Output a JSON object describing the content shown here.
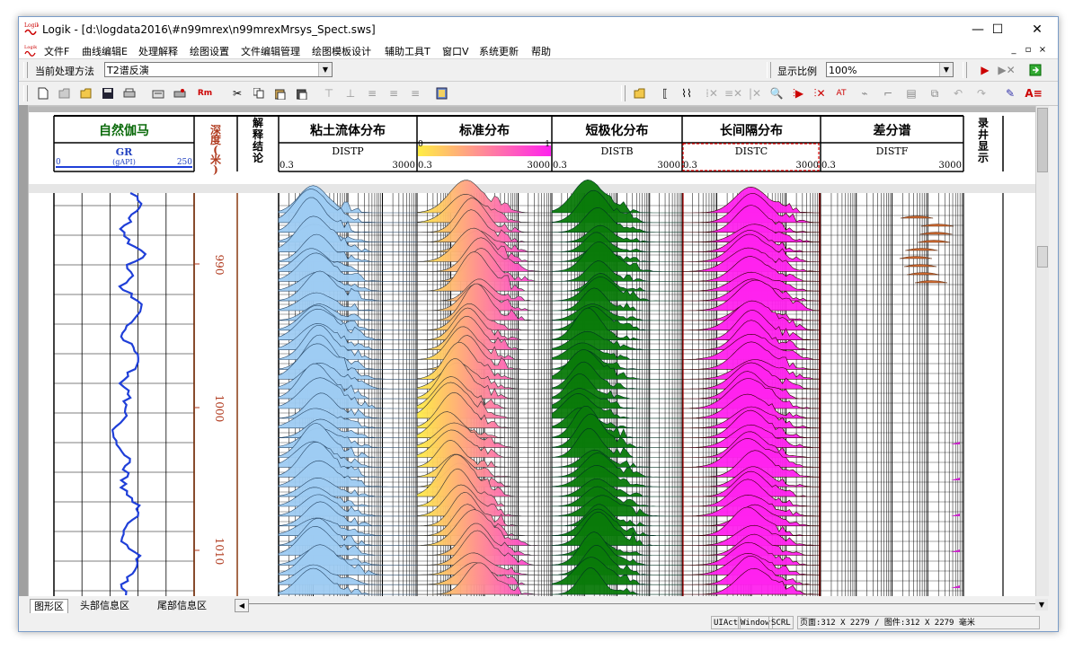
{
  "window": {
    "title": "Logik - [d:\\logdata2016\\#n99mrex\\n99mrexMrsys_Spect.sws]",
    "minimize_icon": "minimize-icon",
    "maximize_icon": "maximize-icon",
    "close_icon": "close-icon"
  },
  "menu": {
    "items": [
      "文件F",
      "曲线编辑E",
      "处理解释",
      "绘图设置",
      "文件编辑管理",
      "绘图模板设计",
      "辅助工具T",
      "窗口V",
      "系统更新",
      "帮助"
    ],
    "mdi_controls": [
      "_",
      "▫",
      "×"
    ]
  },
  "toolbar1": {
    "method_label": "当前处理方法",
    "method_value": "T2谱反演",
    "scale_label": "显示比例",
    "scale_value": "100%"
  },
  "toolbar2": {
    "rm_label": "Rm"
  },
  "tracks": {
    "gr": {
      "title": "自然伽马",
      "curve": "GR",
      "unit": "(gAPI)",
      "min": "0",
      "max": "250"
    },
    "depth": {
      "title": "深度(米)",
      "chars": [
        "深",
        "度",
        "(",
        "米",
        ")"
      ],
      "labels": [
        "990",
        "1000",
        "1010"
      ]
    },
    "interp": {
      "title": "解释结论",
      "chars": [
        "解",
        "释",
        "结",
        "论"
      ]
    },
    "distp": {
      "title": "粘土流体分布",
      "curve": "DISTP",
      "min": "0.3",
      "max": "3000"
    },
    "dista": {
      "title": "标准分布",
      "curve": "DISTA",
      "min": "0.3",
      "max": "3000",
      "cmin": "0",
      "cmax": "1"
    },
    "distb": {
      "title": "短极化分布",
      "curve": "DISTB",
      "min": "0.3",
      "max": "3000"
    },
    "distc": {
      "title": "长间隔分布",
      "curve": "DISTC",
      "min": "0.3",
      "max": "3000"
    },
    "distf": {
      "title": "差分谱",
      "curve": "DISTF",
      "min": "0.3",
      "max": "3000"
    },
    "logging": {
      "title": "录井显示",
      "chars": [
        "录",
        "井",
        "显",
        "示"
      ]
    }
  },
  "colors": {
    "gr_curve": "#1f3fd8",
    "depth_text": "#b03a1e",
    "track_title_green": "#0a6a0a",
    "distp_fill": "#9ecbf2",
    "dista_low": "#ffee44",
    "dista_high": "#ff22ee",
    "distb_fill": "#0a7a0a",
    "distc_fill": "#ff22ee",
    "distf_fill": "#d06a30"
  },
  "tabs": [
    {
      "label": "图形区",
      "active": true
    },
    {
      "label": "头部信息区",
      "active": false
    },
    {
      "label": "尾部信息区",
      "active": false
    }
  ],
  "status": {
    "ui": "UIAct",
    "window": "Window",
    "scrl": "SCRL",
    "page_info": "页面:312 X 2279 / 图件:312 X 2279 毫米"
  }
}
